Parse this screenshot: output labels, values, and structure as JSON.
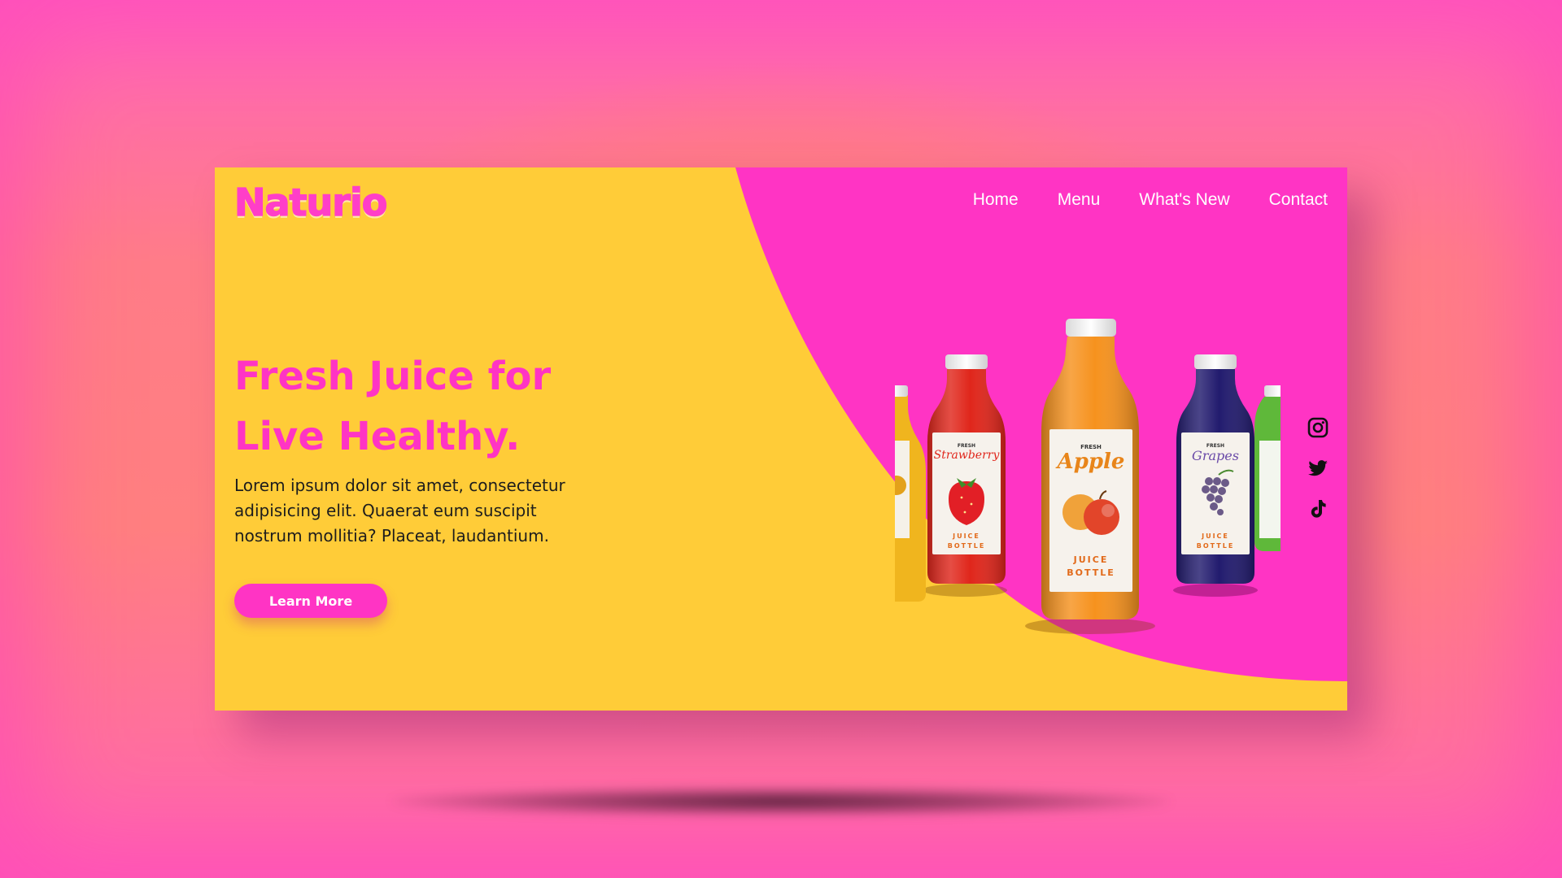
{
  "brand": {
    "logo_text": "Naturio"
  },
  "nav": {
    "items": [
      "Home",
      "Menu",
      "What's New",
      "Contact"
    ]
  },
  "hero": {
    "title_line1": "Fresh Juice for",
    "title_line2": "Live Healthy.",
    "description": "Lorem ipsum dolor sit amet, consectetur adipisicing elit. Quaerat eum suscipit nostrum mollitia? Placeat, laudantium.",
    "cta_label": "Learn More"
  },
  "bottles": [
    {
      "id": "orange-left",
      "label_line1": "",
      "label_line2": "",
      "label_line3": "",
      "color": "#f0b51e"
    },
    {
      "id": "strawberry",
      "label_line1": "FRESH",
      "label_line2": "Strawberry",
      "label_line3": "JUICE BOTTLE",
      "color": "#e0261b"
    },
    {
      "id": "apple",
      "label_line1": "FRESH",
      "label_line2": "Apple",
      "label_line3": "JUICE BOTTLE",
      "color": "#f6921e"
    },
    {
      "id": "grapes",
      "label_line1": "FRESH",
      "label_line2": "Grapes",
      "label_line3": "JUICE BOTTLE",
      "color": "#221b6e"
    },
    {
      "id": "green-right",
      "label_line1": "",
      "label_line2": "",
      "label_line3": "",
      "color": "#5fb83a"
    }
  ],
  "socials": [
    "instagram-icon",
    "twitter-icon",
    "tiktok-icon"
  ],
  "colors": {
    "yellow": "#ffcc38",
    "magenta": "#ff34c4",
    "white": "#ffffff",
    "dark": "#1d1d1d"
  }
}
